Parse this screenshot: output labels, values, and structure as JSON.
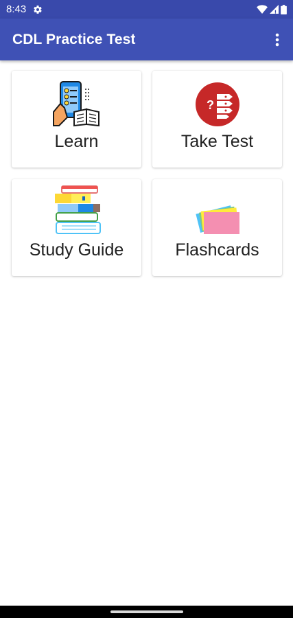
{
  "status_bar": {
    "time": "8:43",
    "icons": [
      "settings-gear-icon",
      "wifi-icon",
      "cellular-signal-icon",
      "battery-icon"
    ]
  },
  "app_bar": {
    "title": "CDL Practice Test",
    "overflow_icon": "more-vert-icon"
  },
  "cards": [
    {
      "label": "Learn",
      "icon": "learn-phone-book-icon"
    },
    {
      "label": "Take Test",
      "icon": "test-question-checklist-icon"
    },
    {
      "label": "Study Guide",
      "icon": "book-stack-icon"
    },
    {
      "label": "Flashcards",
      "icon": "flashcards-icon"
    }
  ],
  "colors": {
    "primary": "#3f51b5",
    "primary_dark": "#3949ab",
    "test_red": "#c62828"
  }
}
